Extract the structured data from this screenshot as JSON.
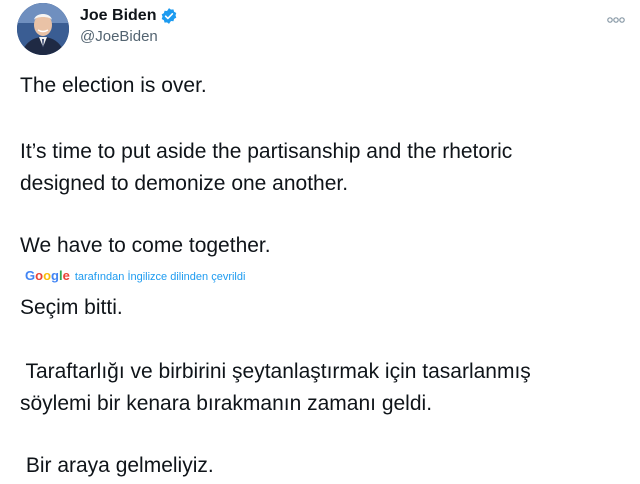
{
  "author": {
    "display_name": "Joe Biden",
    "handle": "@JoeBiden"
  },
  "tweet": {
    "lines": [
      "The election is over.",
      "It’s time to put aside the partisanship and the rhetoric",
      "designed to demonize one another.",
      "We have to come together."
    ]
  },
  "translation": {
    "provider_letters": [
      "G",
      "o",
      "o",
      "g",
      "l",
      "e"
    ],
    "provider_colors": [
      "#4285F4",
      "#EA4335",
      "#FBBC05",
      "#4285F4",
      "#34A853",
      "#EA4335"
    ],
    "note": "tarafından İngilizce dilinden çevrildi",
    "lines": [
      "Seçim bitti.",
      " Taraftarlığı ve birbirini şeytanlaştırmak için tasarlanmış",
      "söylemi bir kenara bırakmanın zamanı geldi.",
      " Bir araya gelmeliyiz."
    ]
  },
  "colors": {
    "verified": "#1d9bf0",
    "link": "#1d9bf0",
    "secondary_text": "#536471"
  },
  "icons": {
    "verified": "verified-badge-icon",
    "more": "more-options-icon"
  }
}
